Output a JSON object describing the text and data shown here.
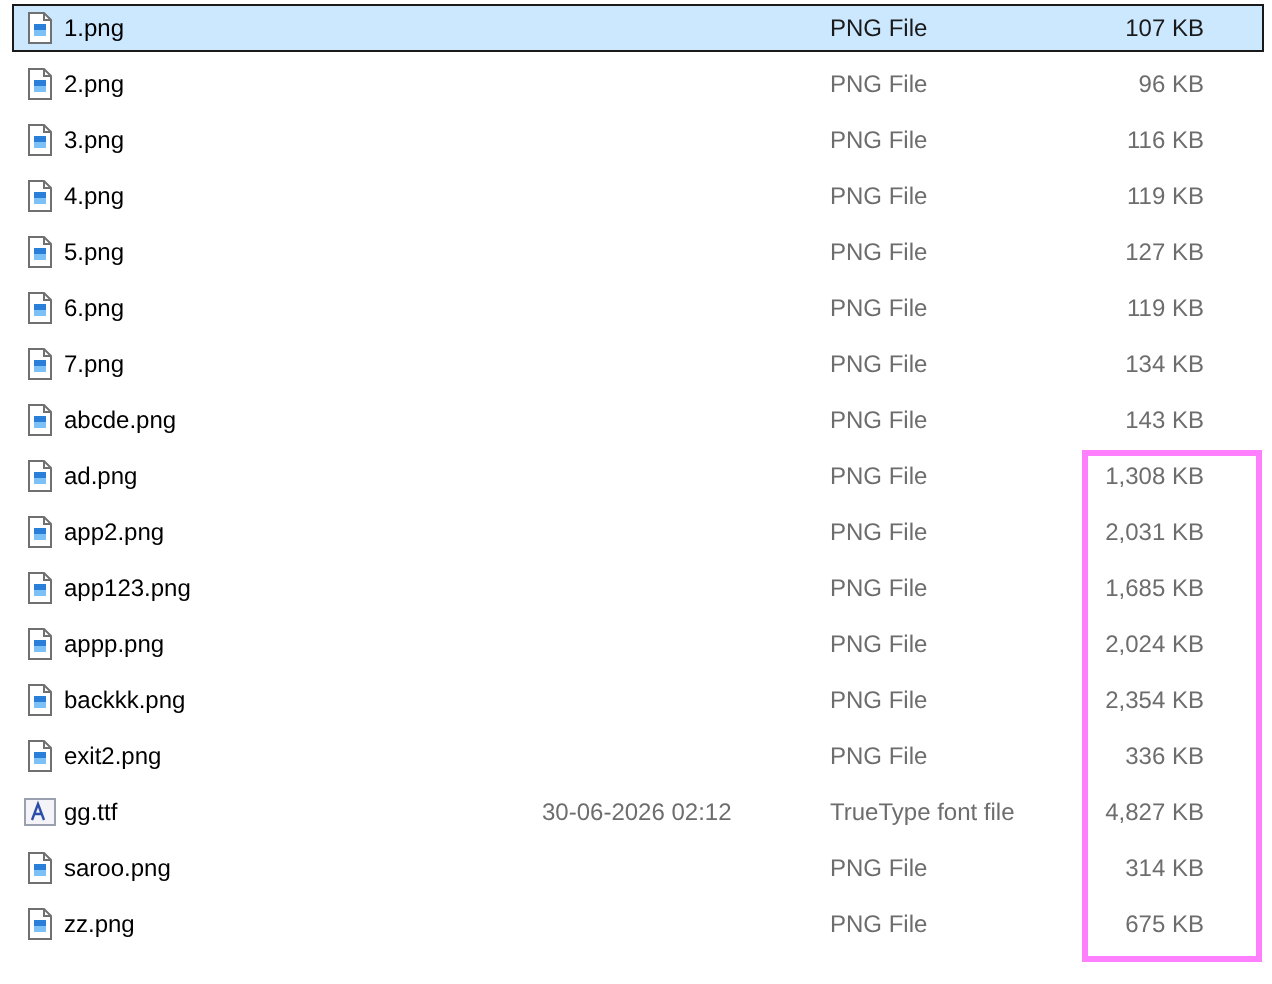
{
  "files": [
    {
      "name": "1.png",
      "kind": "image",
      "type": "PNG File",
      "size": "107 KB",
      "selected": true
    },
    {
      "name": "2.png",
      "kind": "image",
      "type": "PNG File",
      "size": "96 KB",
      "selected": false
    },
    {
      "name": "3.png",
      "kind": "image",
      "type": "PNG File",
      "size": "116 KB",
      "selected": false
    },
    {
      "name": "4.png",
      "kind": "image",
      "type": "PNG File",
      "size": "119 KB",
      "selected": false
    },
    {
      "name": "5.png",
      "kind": "image",
      "type": "PNG File",
      "size": "127 KB",
      "selected": false
    },
    {
      "name": "6.png",
      "kind": "image",
      "type": "PNG File",
      "size": "119 KB",
      "selected": false
    },
    {
      "name": "7.png",
      "kind": "image",
      "type": "PNG File",
      "size": "134 KB",
      "selected": false
    },
    {
      "name": "abcde.png",
      "kind": "image",
      "type": "PNG File",
      "size": "143 KB",
      "selected": false
    },
    {
      "name": "ad.png",
      "kind": "image",
      "type": "PNG File",
      "size": "1,308 KB",
      "selected": false
    },
    {
      "name": "app2.png",
      "kind": "image",
      "type": "PNG File",
      "size": "2,031 KB",
      "selected": false
    },
    {
      "name": "app123.png",
      "kind": "image",
      "type": "PNG File",
      "size": "1,685 KB",
      "selected": false
    },
    {
      "name": "appp.png",
      "kind": "image",
      "type": "PNG File",
      "size": "2,024 KB",
      "selected": false
    },
    {
      "name": "backkk.png",
      "kind": "image",
      "type": "PNG File",
      "size": "2,354 KB",
      "selected": false
    },
    {
      "name": "exit2.png",
      "kind": "image",
      "type": "PNG File",
      "size": "336 KB",
      "selected": false
    },
    {
      "name": "gg.ttf",
      "kind": "font",
      "date": "30-06-2026 02:12",
      "type": "TrueType font file",
      "size": "4,827 KB",
      "selected": false
    },
    {
      "name": "saroo.png",
      "kind": "image",
      "type": "PNG File",
      "size": "314 KB",
      "selected": false
    },
    {
      "name": "zz.png",
      "kind": "image",
      "type": "PNG File",
      "size": "675 KB",
      "selected": false
    }
  ]
}
